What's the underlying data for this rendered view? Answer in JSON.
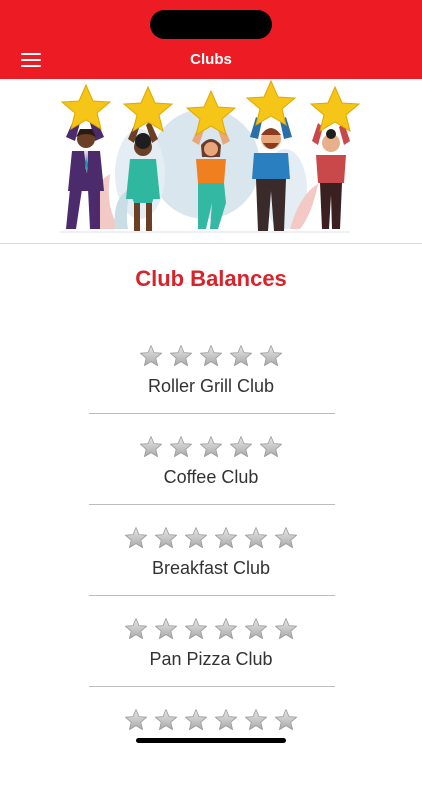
{
  "header": {
    "title": "Clubs",
    "accent_color": "#ed1c24"
  },
  "hero": {
    "illustration": "people-holding-stars"
  },
  "section": {
    "title": "Club Balances",
    "title_color": "#d8232a"
  },
  "clubs": [
    {
      "name": "Roller Grill Club",
      "stars_total": 5,
      "stars_filled": 0
    },
    {
      "name": "Coffee Club",
      "stars_total": 5,
      "stars_filled": 0
    },
    {
      "name": "Breakfast Club",
      "stars_total": 6,
      "stars_filled": 0
    },
    {
      "name": "Pan Pizza Club",
      "stars_total": 6,
      "stars_filled": 0
    },
    {
      "name": "",
      "stars_total": 6,
      "stars_filled": 0
    }
  ],
  "icons": {
    "menu": "hamburger-menu-icon",
    "star": "star-icon"
  }
}
